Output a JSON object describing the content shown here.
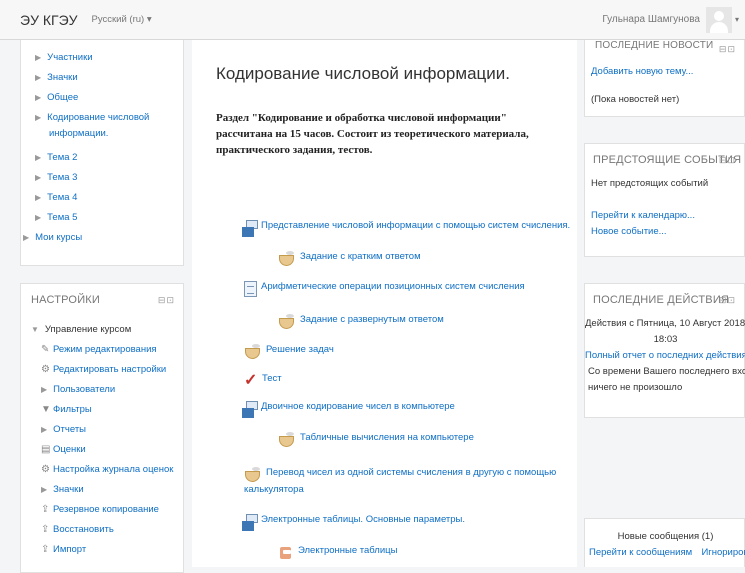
{
  "navbar": {
    "brand": "ЭУ КГЭУ",
    "language": "Русский (ru) ▾",
    "user_name": "Гульнара Шамгунова",
    "user_caret": "▾"
  },
  "nav_tree": {
    "items": [
      {
        "label": "Участники"
      },
      {
        "label": "Значки"
      },
      {
        "label": "Общее"
      },
      {
        "label": "Кодирование числовой"
      },
      {
        "label": "информации."
      },
      {
        "label": "Тема 2"
      },
      {
        "label": "Тема 3"
      },
      {
        "label": "Тема 4"
      },
      {
        "label": "Тема 5"
      }
    ],
    "my_courses": "Мои курсы"
  },
  "settings": {
    "title": "НАСТРОЙКИ",
    "dock": "⊟⊡",
    "manage": "Управление курсом",
    "items": [
      {
        "label": "Режим редактирования",
        "icon": "pencil-icon"
      },
      {
        "label": "Редактировать настройки",
        "icon": "gear-icon"
      },
      {
        "label": "Пользователи",
        "icon": "arrow-icon"
      },
      {
        "label": "Фильтры",
        "icon": "filter-icon"
      },
      {
        "label": "Отчеты",
        "icon": "arrow-icon"
      },
      {
        "label": "Оценки",
        "icon": "grades-icon"
      },
      {
        "label": "Настройка журнала оценок",
        "icon": "gear-icon"
      },
      {
        "label": "Значки",
        "icon": "arrow-icon"
      },
      {
        "label": "Резервное копирование",
        "icon": "backup-icon"
      },
      {
        "label": "Восстановить",
        "icon": "restore-icon"
      },
      {
        "label": "Импорт",
        "icon": "import-icon"
      }
    ]
  },
  "main": {
    "title": "Кодирование числовой информации.",
    "summary": "Раздел \"Кодирование и обработка числовой информации\" рассчитана на 15 часов. Состоит из теоретического материала, практического задания, тестов.",
    "activities": [
      {
        "label": "Представление числовой информации с помощью систем счисления.",
        "icon": "book-icon"
      },
      {
        "label": "Задание с кратким ответом",
        "icon": "lesson-icon"
      },
      {
        "label": "Арифметические операции позиционных систем счисления",
        "icon": "page-icon"
      },
      {
        "label": "Задание с развернутым ответом",
        "icon": "lesson-icon"
      },
      {
        "label": "Решение задач",
        "icon": "lesson-icon"
      },
      {
        "label": "Тест",
        "icon": "quiz-check-icon"
      },
      {
        "label": "Двоичное кодирование чисел в компьютере",
        "icon": "book-icon"
      },
      {
        "label": "Табличные вычисления на компьютере",
        "icon": "lesson-icon"
      },
      {
        "label": "Перевод чисел из одной системы счисления в другую с помощью",
        "icon": "lesson-icon"
      },
      {
        "label": "калькулятора",
        "icon": ""
      },
      {
        "label": "Электронные таблицы. Основные параметры.",
        "icon": "book-icon"
      },
      {
        "label": "Электронные таблицы",
        "icon": "sheet-icon"
      }
    ]
  },
  "news": {
    "title": "ПОСЛЕДНИЕ НОВОСТИ",
    "dock": "⊟⊡",
    "add_link": "Добавить новую тему...",
    "empty": "(Пока новостей нет)"
  },
  "events": {
    "title": "ПРЕДСТОЯЩИЕ СОБЫТИЯ",
    "dock": "⊟⊡",
    "empty": "Нет предстоящих событий",
    "calendar_link": "Перейти к календарю...",
    "new_event_link": "Новое событие..."
  },
  "activity": {
    "title": "ПОСЛЕДНИЕ ДЕЙСТВИЯ",
    "dock": "⊟⊡",
    "line1": "Действия с Пятница, 10 Август 2018,",
    "line2": "18:03",
    "report_link": "Полный отчет о последних действиях",
    "line3": "Со времени Вашего последнего входа",
    "line4": "ничего не произошло"
  },
  "messages": {
    "new": "Новые сообщения (1)",
    "goto_link": "Перейти к сообщениям",
    "ignore_link": "Игнорировать"
  }
}
